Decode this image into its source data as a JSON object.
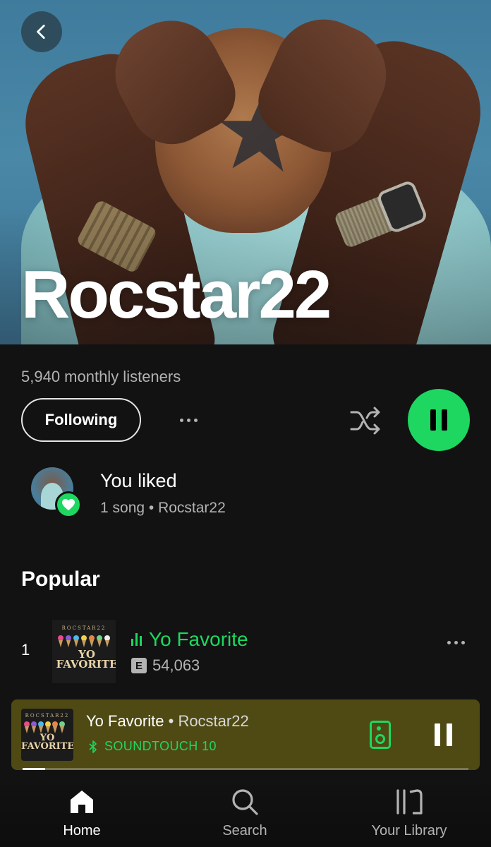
{
  "hero": {
    "artist_name": "Rocstar22",
    "back_icon": "chevron-left-icon"
  },
  "artist": {
    "monthly_listeners": "5,940 monthly listeners",
    "following_label": "Following",
    "more_icon": "more-horizontal-icon",
    "shuffle_icon": "shuffle-icon",
    "play_state": "playing"
  },
  "liked": {
    "title": "You liked",
    "subtitle": "1 song • Rocstar22"
  },
  "popular": {
    "heading": "Popular",
    "tracks": [
      {
        "rank": "1",
        "title": "Yo Favorite",
        "explicit": "E",
        "plays": "54,063",
        "art_top": "ROCSTAR22",
        "art_word": "YO FAVORITE"
      }
    ]
  },
  "now_playing": {
    "title": "Yo Favorite",
    "separator": "•",
    "artist": "Rocstar22",
    "device": "SOUNDTOUCH 10",
    "progress": 0.05,
    "accent": "#1ed760",
    "bar_color": "#4f4a14"
  },
  "nav": {
    "items": [
      {
        "label": "Home",
        "icon": "home-icon",
        "active": true
      },
      {
        "label": "Search",
        "icon": "search-icon",
        "active": false
      },
      {
        "label": "Your Library",
        "icon": "library-icon",
        "active": false
      }
    ]
  },
  "colors": {
    "background": "#121212",
    "accent": "#1ed760",
    "secondary_text": "#b3b3b3"
  }
}
